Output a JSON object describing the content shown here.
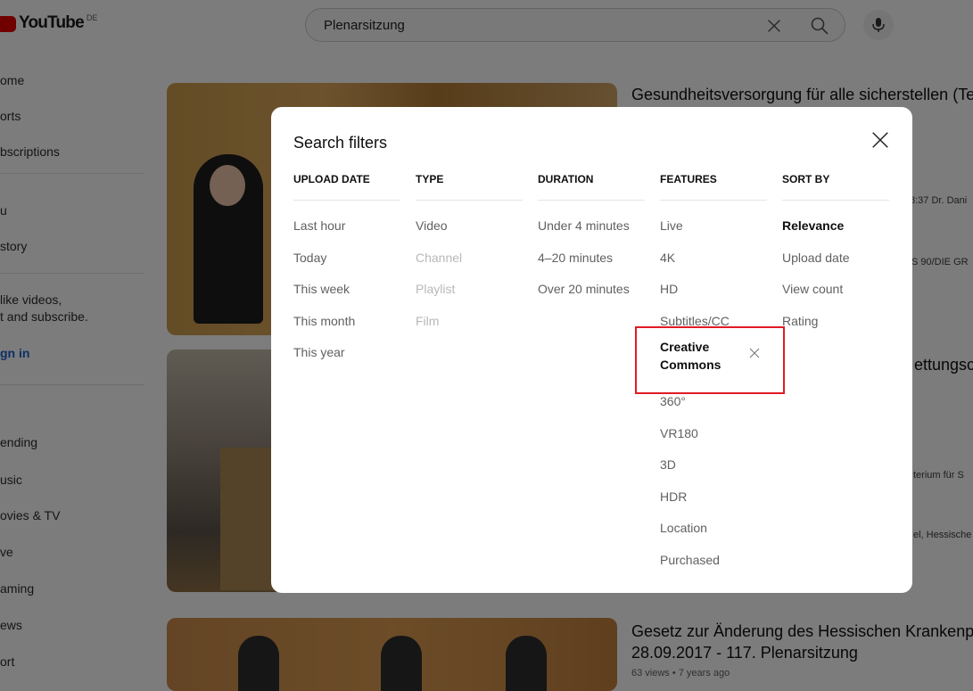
{
  "header": {
    "logo_text": "YouTube",
    "logo_region": "DE",
    "search_query": "Plenarsitzung"
  },
  "sidebar": {
    "items": [
      "ome",
      "orts",
      "bscriptions",
      "u",
      "story"
    ],
    "signin_prompt": [
      "like videos,",
      "t and subscribe."
    ],
    "signin_label": "gn in",
    "explore_items": [
      "ending",
      "usic",
      "ovies & TV",
      "ve",
      "aming",
      "ews",
      "ort"
    ]
  },
  "videos": {
    "title_1": "Gesundheitsversorgung für alle sicherstellen (Te",
    "frag_1a": "8:37 Dr. Dani",
    "frag_1b": "S 90/DIE GR",
    "title_2": "ettungsc",
    "frag_2a": "terium für S",
    "frag_2b": "el, Hessische",
    "title_3a": "Gesetz zur Änderung des Hessischen Krankenpf",
    "title_3b": "28.09.2017 - 117. Plenarsitzung",
    "meta_3": "63 views • 7 years ago"
  },
  "dialog": {
    "title": "Search filters",
    "columns": [
      {
        "header": "UPLOAD DATE",
        "options": [
          "Last hour",
          "Today",
          "This week",
          "This month",
          "This year"
        ]
      },
      {
        "header": "TYPE",
        "options": [
          "Video",
          "Channel",
          "Playlist",
          "Film"
        ]
      },
      {
        "header": "DURATION",
        "options": [
          "Under 4 minutes",
          "4–20 minutes",
          "Over 20 minutes"
        ]
      },
      {
        "header": "FEATURES",
        "options": [
          "Live",
          "4K",
          "HD",
          "Subtitles/CC",
          "Creative Commons",
          "360°",
          "VR180",
          "3D",
          "HDR",
          "Location",
          "Purchased"
        ]
      },
      {
        "header": "SORT BY",
        "options": [
          "Relevance",
          "Upload date",
          "View count",
          "Rating"
        ]
      }
    ]
  },
  "colors": {
    "highlight": "#e01b24",
    "brand": "#e00000",
    "link": "#1a5fc9"
  }
}
